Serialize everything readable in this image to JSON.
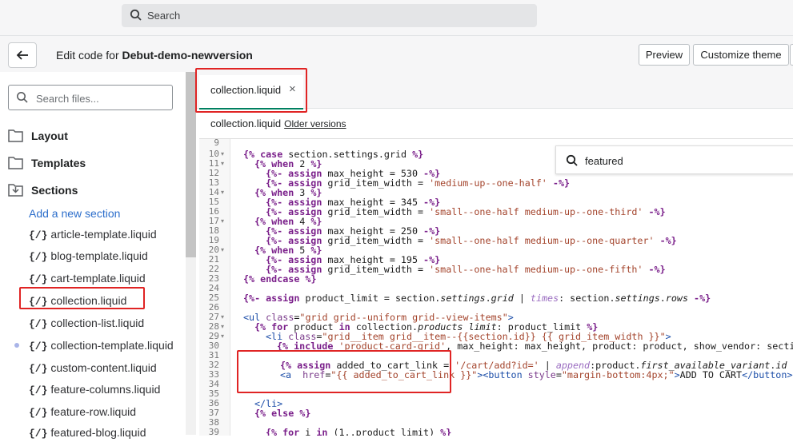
{
  "topbar": {
    "search_placeholder": "Search"
  },
  "header": {
    "title_prefix": "Edit code for",
    "theme_name": "Debut-demo-newversion",
    "preview_label": "Preview",
    "customize_label": "Customize theme"
  },
  "sidebar": {
    "search_placeholder": "Search files...",
    "folders": [
      {
        "label": "Layout",
        "icon": "folder-icon"
      },
      {
        "label": "Templates",
        "icon": "folder-icon"
      },
      {
        "label": "Sections",
        "icon": "folder-open-icon"
      }
    ],
    "add_section": "Add a new section",
    "file_icon_text": "{/}",
    "files": [
      "article-template.liquid",
      "blog-template.liquid",
      "cart-template.liquid",
      "collection.liquid",
      "collection-list.liquid",
      "collection-template.liquid",
      "custom-content.liquid",
      "feature-columns.liquid",
      "feature-row.liquid",
      "featured-blog.liquid"
    ]
  },
  "tab": {
    "label": "collection.liquid",
    "close": "×"
  },
  "file_info": {
    "name": "collection.liquid",
    "older_versions": "Older versions"
  },
  "find": {
    "value": "featured"
  },
  "line_numbers": [
    "9",
    "10",
    "11",
    "12",
    "13",
    "14",
    "15",
    "16",
    "17",
    "18",
    "19",
    "20",
    "21",
    "22",
    "23",
    "24",
    "25",
    "26",
    "27",
    "28",
    "29",
    "30",
    "31",
    "32",
    "33",
    "34",
    "35",
    "36",
    "37",
    "38",
    "39"
  ],
  "colors": {
    "accent": "#008060",
    "highlight": "#e02424",
    "link": "#2c6ecb"
  }
}
